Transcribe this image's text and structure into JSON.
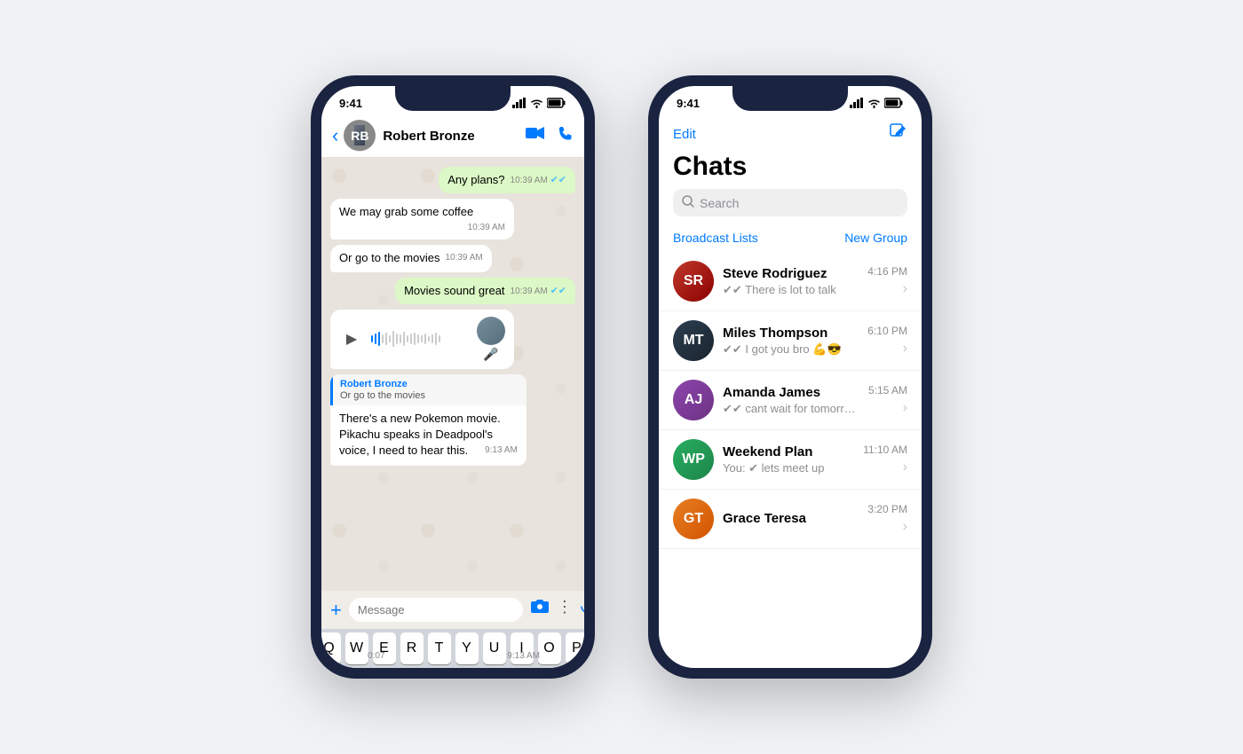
{
  "phone1": {
    "status_time": "9:41",
    "header": {
      "contact_name": "Robert Bronze",
      "avatar_initials": "RB"
    },
    "messages": [
      {
        "id": "msg1",
        "type": "outgoing",
        "text": "Any plans?",
        "time": "10:39 AM",
        "ticks": "double"
      },
      {
        "id": "msg2",
        "type": "incoming",
        "text": "We may grab some coffee",
        "time": "10:39 AM"
      },
      {
        "id": "msg3",
        "type": "incoming",
        "text": "Or go to the movies",
        "time": "10:39 AM"
      },
      {
        "id": "msg4",
        "type": "outgoing",
        "text": "Movies sound great",
        "time": "10:39 AM",
        "ticks": "double"
      },
      {
        "id": "msg5",
        "type": "voice",
        "duration": "0:07",
        "time": "9:13 AM"
      },
      {
        "id": "msg6",
        "type": "quote",
        "quote_name": "Robert Bronze",
        "quote_text": "Or go to the movies",
        "body": "There's a new Pokemon movie. Pikachu speaks in Deadpool's voice, I need to hear this.",
        "time": "9:13 AM"
      }
    ],
    "input_placeholder": "Message",
    "keyboard_row1": [
      "Q",
      "W",
      "E",
      "R",
      "T",
      "Y",
      "U",
      "I",
      "O",
      "P"
    ]
  },
  "phone2": {
    "status_time": "9:41",
    "header": {
      "edit_label": "Edit",
      "title": "Chats",
      "search_placeholder": "Search",
      "broadcast_label": "Broadcast Lists",
      "new_group_label": "New Group"
    },
    "chat_list": [
      {
        "id": "chat1",
        "name": "Steve Rodriguez",
        "time": "4:16 PM",
        "preview": "✔✔ There is lot to talk",
        "avatar_initials": "SR",
        "avatar_class": "av-steve"
      },
      {
        "id": "chat2",
        "name": "Miles Thompson",
        "time": "6:10 PM",
        "preview": "✔✔ I got you bro 💪😎",
        "avatar_initials": "MT",
        "avatar_class": "av-miles"
      },
      {
        "id": "chat3",
        "name": "Amanda James",
        "time": "5:15 AM",
        "preview": "✔✔ cant wait for tomorrow 😒😍😍",
        "avatar_initials": "AJ",
        "avatar_class": "av-amanda"
      },
      {
        "id": "chat4",
        "name": "Weekend Plan",
        "time": "11:10 AM",
        "preview": "You: ✔ lets meet up",
        "avatar_initials": "WP",
        "avatar_class": "av-weekend"
      },
      {
        "id": "chat5",
        "name": "Grace Teresa",
        "time": "3:20 PM",
        "preview": "",
        "avatar_initials": "GT",
        "avatar_class": "av-grace"
      }
    ]
  }
}
